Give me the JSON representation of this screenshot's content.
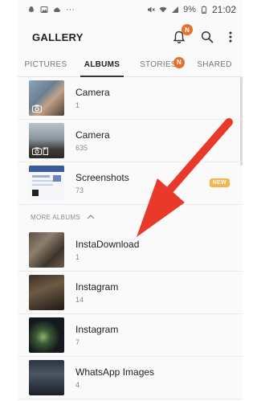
{
  "status": {
    "battery": "9%",
    "time": "21:02"
  },
  "app": {
    "title": "GALLERY",
    "notification_badge": "N"
  },
  "tabs": [
    {
      "label": "PICTURES",
      "active": false
    },
    {
      "label": "ALBUMS",
      "active": true
    },
    {
      "label": "STORIES",
      "active": false,
      "badge": "N"
    },
    {
      "label": "SHARED",
      "active": false
    }
  ],
  "albums": [
    {
      "name": "Camera",
      "count": "1"
    },
    {
      "name": "Camera",
      "count": "635"
    },
    {
      "name": "Screenshots",
      "count": "73",
      "badge": "NEW"
    }
  ],
  "more_albums": {
    "header": "MORE ALBUMS",
    "items": [
      {
        "name": "InstaDownload",
        "count": "1"
      },
      {
        "name": "Instagram",
        "count": "14"
      },
      {
        "name": "Instagram",
        "count": "7"
      },
      {
        "name": "WhatsApp Images",
        "count": "4"
      }
    ]
  },
  "colors": {
    "accent_badge": "#e3712a",
    "new_badge": "#f3b64c",
    "arrow": "#e8392a"
  }
}
